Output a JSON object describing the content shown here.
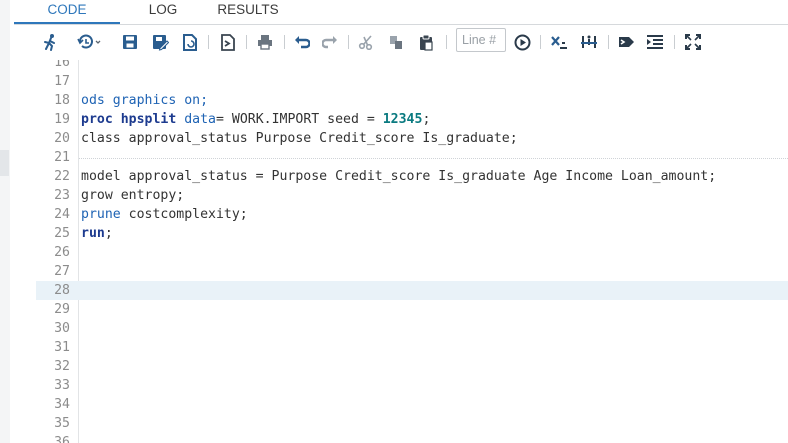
{
  "tabs": [
    {
      "label": "CODE",
      "active": true
    },
    {
      "label": "LOG",
      "active": false
    },
    {
      "label": "RESULTS",
      "active": false
    }
  ],
  "toolbar": {
    "line_placeholder": "Line #",
    "icons": [
      "run-icon",
      "history-icon",
      "save-icon",
      "save-as-icon",
      "new-program-icon",
      "export-icon",
      "print-icon",
      "undo-icon",
      "redo-icon",
      "cut-icon",
      "copy-icon",
      "paste-icon",
      "submit-line-icon",
      "clear-icon",
      "format-code-icon",
      "snippet-icon",
      "toggle-list-icon",
      "maximize-icon"
    ]
  },
  "colors": {
    "accent": "#2e77bb",
    "keyword": "#1d3b8f",
    "statement": "#1e63b4",
    "number": "#0a7a80",
    "current_line": "#e9f2f8"
  },
  "editor": {
    "lines": [
      {
        "n": "16",
        "parts": []
      },
      {
        "n": "17",
        "parts": []
      },
      {
        "n": "18",
        "parts": [
          {
            "t": "ods graphics on;",
            "c": "stmt"
          }
        ]
      },
      {
        "n": "19",
        "parts": [
          {
            "t": "proc hpsplit",
            "c": "kw"
          },
          {
            "t": " "
          },
          {
            "t": "data",
            "c": "stmt"
          },
          {
            "t": "= WORK.IMPORT seed = "
          },
          {
            "t": "12345",
            "c": "num"
          },
          {
            "t": ";"
          }
        ]
      },
      {
        "n": "20",
        "parts": [
          {
            "t": "class approval_status Purpose Credit_score Is_graduate;"
          }
        ]
      },
      {
        "n": "21",
        "parts": []
      },
      {
        "n": "22",
        "parts": [
          {
            "t": "model approval_status = Purpose Credit_score Is_graduate Age Income Loan_amount;"
          }
        ]
      },
      {
        "n": "23",
        "parts": [
          {
            "t": "grow entropy;"
          }
        ]
      },
      {
        "n": "24",
        "parts": [
          {
            "t": "prune",
            "c": "stmt"
          },
          {
            "t": " costcomplexity;"
          }
        ]
      },
      {
        "n": "25",
        "parts": [
          {
            "t": "run",
            "c": "kw"
          },
          {
            "t": ";"
          }
        ]
      },
      {
        "n": "26",
        "parts": []
      },
      {
        "n": "27",
        "parts": []
      },
      {
        "n": "28",
        "parts": [],
        "current": true
      },
      {
        "n": "29",
        "parts": []
      },
      {
        "n": "30",
        "parts": []
      },
      {
        "n": "31",
        "parts": []
      },
      {
        "n": "32",
        "parts": []
      },
      {
        "n": "33",
        "parts": []
      },
      {
        "n": "34",
        "parts": []
      },
      {
        "n": "35",
        "parts": []
      },
      {
        "n": "36",
        "parts": []
      }
    ]
  }
}
